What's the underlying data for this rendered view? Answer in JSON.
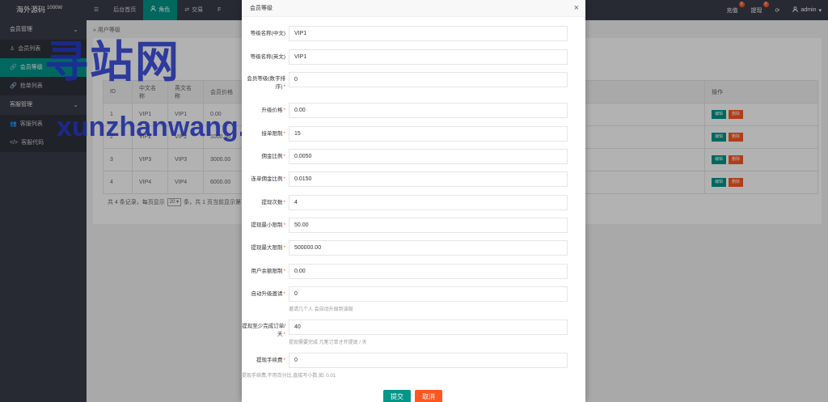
{
  "header": {
    "logo": "海外源码",
    "logo_sup": "1000W",
    "nav": [
      {
        "label": "",
        "icon": "menu-icon"
      },
      {
        "label": "后台首页"
      },
      {
        "label": "角色",
        "icon": "user-icon"
      },
      {
        "label": "交易",
        "icon": "exchange-icon"
      },
      {
        "label": "F"
      }
    ],
    "right": {
      "recharge": "充值",
      "recharge_count": "0",
      "withdraw": "提现",
      "withdraw_count": "0",
      "user": "admin"
    }
  },
  "sidebar": {
    "groups": [
      {
        "label": "会员管理",
        "items": [
          {
            "label": "会员列表",
            "icon": "user-icon"
          },
          {
            "label": "会员等级",
            "icon": "link-icon",
            "active": true
          },
          {
            "label": "抢单列表",
            "icon": "link-icon"
          }
        ]
      },
      {
        "label": "客服管理",
        "items": [
          {
            "label": "客服列表",
            "icon": "users-icon"
          },
          {
            "label": "客服代码",
            "icon": "code-icon"
          }
        ]
      }
    ]
  },
  "main": {
    "breadcrumb": "用户等级",
    "table": {
      "headers": [
        "ID",
        "中文名称",
        "英文名称",
        "会员价格"
      ],
      "action_header": "操作",
      "rows": [
        {
          "id": "1",
          "cn": "VIP1",
          "en": "VIP1",
          "price": "0.00"
        },
        {
          "id": "2",
          "cn": "VIP2",
          "en": "VIP2",
          "price": "1000.00"
        },
        {
          "id": "3",
          "cn": "VIP3",
          "en": "VIP3",
          "price": "3000.00"
        },
        {
          "id": "4",
          "cn": "VIP4",
          "en": "VIP4",
          "price": "6000.00"
        }
      ],
      "edit_label": "编辑",
      "delete_label": "删除"
    },
    "pager": {
      "prefix": "共 4 条记录，每页显示",
      "page_size": "20",
      "suffix": "条，共 1 页当前显示第 1 页"
    }
  },
  "modal": {
    "title": "会员等级",
    "fields": [
      {
        "label": "等级名称(中文)",
        "value": "VIP1",
        "required": false
      },
      {
        "label": "等级名称(英文)",
        "value": "VIP1",
        "required": false
      },
      {
        "label": "会员等级(数字排序)",
        "value": "0",
        "required": true
      },
      {
        "label": "升级价格",
        "value": "0.00",
        "required": true
      },
      {
        "label": "接单限制",
        "value": "15",
        "required": true
      },
      {
        "label": "佣金比例",
        "value": "0.0050",
        "required": true
      },
      {
        "label": "连单佣金比例",
        "value": "0.0150",
        "required": true
      },
      {
        "label": "提现次数",
        "value": "4",
        "required": true
      },
      {
        "label": "提现最小限制",
        "value": "50.00",
        "required": true
      },
      {
        "label": "提现最大限制",
        "value": "500000.00",
        "required": true
      },
      {
        "label": "用户余额限制",
        "value": "0.00",
        "required": true
      },
      {
        "label": "自动升级邀请",
        "value": "0",
        "required": true,
        "hint": "邀请几个人 会自动升级到该级"
      },
      {
        "label": "提现至少完成订单/天",
        "value": "40",
        "required": true,
        "hint": "提现需要完成 几笔订单才开提现 / 天"
      },
      {
        "label": "提现手续费",
        "value": "0",
        "required": true
      }
    ],
    "fee_note": "提现手续费,不用百分比,直接写小数,如: 0.01",
    "submit_label": "提交",
    "cancel_label": "取消"
  },
  "watermark": {
    "line1": "寻站网",
    "line2": "xunzhanwang.com"
  }
}
